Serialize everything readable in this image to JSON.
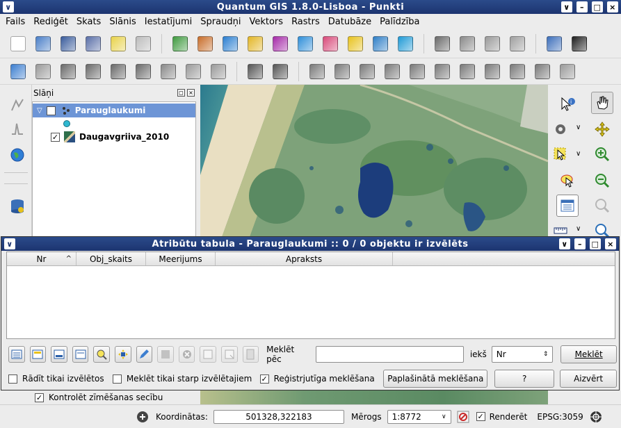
{
  "app": {
    "title": "Quantum GIS 1.8.0-Lisboa - Punkti",
    "window_menu_glyph": "∨",
    "window_buttons": [
      "∨",
      "–",
      "□",
      "×"
    ]
  },
  "menu": [
    "Fails",
    "Rediģēt",
    "Skats",
    "Slānis",
    "Iestatījumi",
    "Spraudņi",
    "Vektors",
    "Rastrs",
    "Datubāze",
    "Palīdzība"
  ],
  "toolbar1": [
    {
      "name": "new-project-icon",
      "color": "#ffffff"
    },
    {
      "name": "open-project-icon",
      "color": "#4a7fc8"
    },
    {
      "name": "save-project-icon",
      "color": "#3a5c9c"
    },
    {
      "name": "save-as-icon",
      "color": "#5a6fa8"
    },
    {
      "name": "new-print-composer-icon",
      "color": "#e8d24a"
    },
    {
      "name": "print-icon",
      "color": "#bcbcbc"
    },
    {
      "name": "add-vector-layer-icon",
      "color": "#3f9a3f"
    },
    {
      "name": "add-raster-layer-icon",
      "color": "#c86d2a"
    },
    {
      "name": "add-postgis-layer-icon",
      "color": "#2b7fd1"
    },
    {
      "name": "add-spatialite-layer-icon",
      "color": "#e3b626"
    },
    {
      "name": "add-mssql-layer-icon",
      "color": "#a52aa8"
    },
    {
      "name": "add-wms-layer-icon",
      "color": "#2f8fd9"
    },
    {
      "name": "add-wfs-layer-icon",
      "color": "#d84a7a"
    },
    {
      "name": "add-delimited-text-layer-icon",
      "color": "#e8c21d"
    },
    {
      "name": "remove-layer-icon",
      "color": "#2f7fc7"
    },
    {
      "name": "new-shapefile-icon",
      "color": "#1f9ad6"
    },
    {
      "name": "spell-check-icon",
      "color": "#6a6a6a"
    },
    {
      "name": "label-tool-icon",
      "color": "#8a8a8a"
    },
    {
      "name": "tag-icon",
      "color": "#9a9a9a"
    },
    {
      "name": "plugin-icon",
      "color": "#a0a0a0"
    },
    {
      "name": "help-book-icon",
      "color": "#3d6fbb"
    },
    {
      "name": "whats-this-icon",
      "color": "#1e1e1e"
    }
  ],
  "toolbar2": [
    {
      "name": "toggle-editing-icon",
      "color": "#3d7fd0"
    },
    {
      "name": "save-edits-icon",
      "color": "#9a9a9a"
    },
    {
      "name": "add-feature-icon",
      "color": "#6a6a6a"
    },
    {
      "name": "move-feature-icon",
      "color": "#6a6a6a"
    },
    {
      "name": "node-tool-icon",
      "color": "#6a6a6a"
    },
    {
      "name": "delete-selected-icon",
      "color": "#6a6a6a"
    },
    {
      "name": "cut-features-icon",
      "color": "#8a8a8a"
    },
    {
      "name": "copy-features-icon",
      "color": "#9a9a9a"
    },
    {
      "name": "paste-features-icon",
      "color": "#9a9a9a"
    },
    {
      "name": "undo-icon",
      "color": "#555555"
    },
    {
      "name": "redo-icon",
      "color": "#555555"
    },
    {
      "name": "simplify-feature-icon",
      "color": "#7a7a7a"
    },
    {
      "name": "add-ring-icon",
      "color": "#7a7a7a"
    },
    {
      "name": "add-part-icon",
      "color": "#7a7a7a"
    },
    {
      "name": "delete-ring-icon",
      "color": "#7a7a7a"
    },
    {
      "name": "delete-part-icon",
      "color": "#7a7a7a"
    },
    {
      "name": "reshape-features-icon",
      "color": "#7a7a7a"
    },
    {
      "name": "offset-curve-icon",
      "color": "#7a7a7a"
    },
    {
      "name": "split-features-icon",
      "color": "#7a7a7a"
    },
    {
      "name": "merge-features-icon",
      "color": "#7a7a7a"
    },
    {
      "name": "merge-attributes-icon",
      "color": "#7a7a7a"
    },
    {
      "name": "rotate-point-symbols-icon",
      "color": "#9a9a9a"
    }
  ],
  "layers_panel": {
    "title": "Slāņi",
    "layers": [
      {
        "name": "Parauglaukumi",
        "checked": true,
        "selected": true
      },
      {
        "name": "Daugavgriiva_2010",
        "checked": true,
        "selected": false
      }
    ]
  },
  "attribute_table": {
    "title": "Atribūtu tabula - Parauglaukumi :: 0 / 0 objektu ir izvēlēts",
    "columns": [
      "Nr",
      "Obj_skaits",
      "Meerijums",
      "Apraksts"
    ],
    "sort_indicator": "^",
    "search_label": "Meklēt pēc",
    "search_value": "",
    "in_label": "iekš",
    "field_select": "Nr",
    "search_button": "Meklēt",
    "show_selected_only": {
      "label": "Rādīt tikai izvēlētos",
      "checked": false
    },
    "search_selected_only": {
      "label": "Meklēt tikai starp izvēlētajiem",
      "checked": false
    },
    "case_sensitive": {
      "label": "Reģistrjutīga meklēšana",
      "checked": true
    },
    "advanced_search_button": "Paplašinātā meklēšana",
    "help_button": "?",
    "close_button": "Aizvērt"
  },
  "render_order": {
    "label": "Kontrolēt zīmēšanas secību",
    "checked": true
  },
  "statusbar": {
    "coordinates_label": "Koordinātas:",
    "coordinates_value": "501328,322183",
    "scale_label": "Mērogs",
    "scale_value": "1:8772",
    "render_label": "Renderēt",
    "render_checked": true,
    "crs": "EPSG:3059"
  },
  "colors": {
    "titlebar": "#1c3470",
    "selected_layer": "#6d95d6",
    "map_land": "#6d9873",
    "map_water": "#1c3d7c",
    "map_beach": "#e9dfc2",
    "map_sea": "#2f7c8f"
  }
}
